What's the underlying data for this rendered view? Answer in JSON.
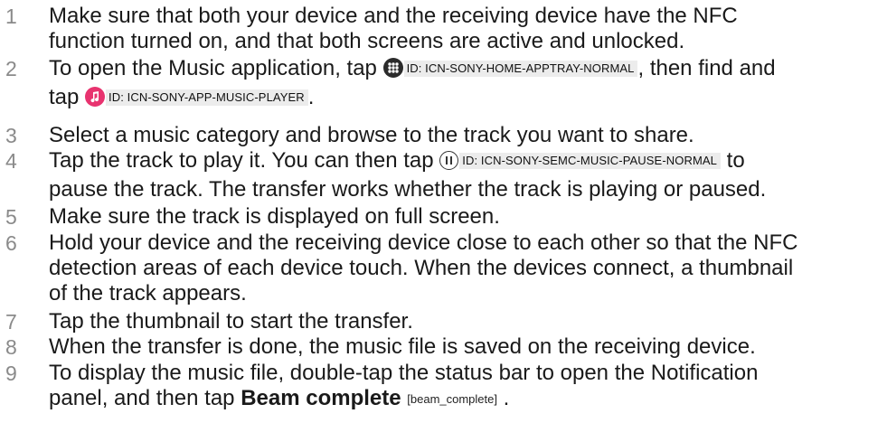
{
  "steps": [
    {
      "num": "1",
      "line1": "Make sure that both your device and the receiving device have the NFC",
      "line2": "function turned on, and that both screens are active and unlocked."
    },
    {
      "num": "2",
      "pre": "To open the Music application, tap ",
      "ref1": "ID: ICN-SONY-HOME-APPTRAY-NORMAL",
      "mid": ", then find and",
      "line2_pre": "tap ",
      "ref2": "ID: ICN-SONY-APP-MUSIC-PLAYER",
      "line2_post": "."
    },
    {
      "num": "3",
      "line1": "Select a music category and browse to the track you want to share."
    },
    {
      "num": "4",
      "pre": "Tap the track to play it. You can then tap ",
      "ref1": "ID: ICN-SONY-SEMC-MUSIC-PAUSE-NORMAL",
      "post": " to",
      "line2": "pause the track. The transfer works whether the track is playing or paused."
    },
    {
      "num": "5",
      "line1": "Make sure the track is displayed on full screen."
    },
    {
      "num": "6",
      "line1": "Hold your device and the receiving device close to each other so that the NFC",
      "line2": "detection areas of each device touch. When the devices connect, a thumbnail",
      "line3": "of the track appears."
    },
    {
      "num": "7",
      "line1": "Tap the thumbnail to start the transfer."
    },
    {
      "num": "8",
      "line1": "When the transfer is done, the music file is saved on the receiving device."
    },
    {
      "num": "9",
      "line1": "To display the music file, double-tap the status bar to open the Notification",
      "line2_pre": "panel, and then tap ",
      "bold": "Beam complete",
      "ref": "[beam_complete]",
      "line2_post": "."
    }
  ],
  "icons": {
    "apptray": "apptray-icon",
    "music": "music-player-icon",
    "pause": "pause-icon"
  },
  "colors": {
    "text": "#1a1a1a",
    "number": "#8a8a8a",
    "ref_background": "#ececec",
    "music_icon": "#e8336f",
    "apptray_icon": "#2b2b2b"
  }
}
